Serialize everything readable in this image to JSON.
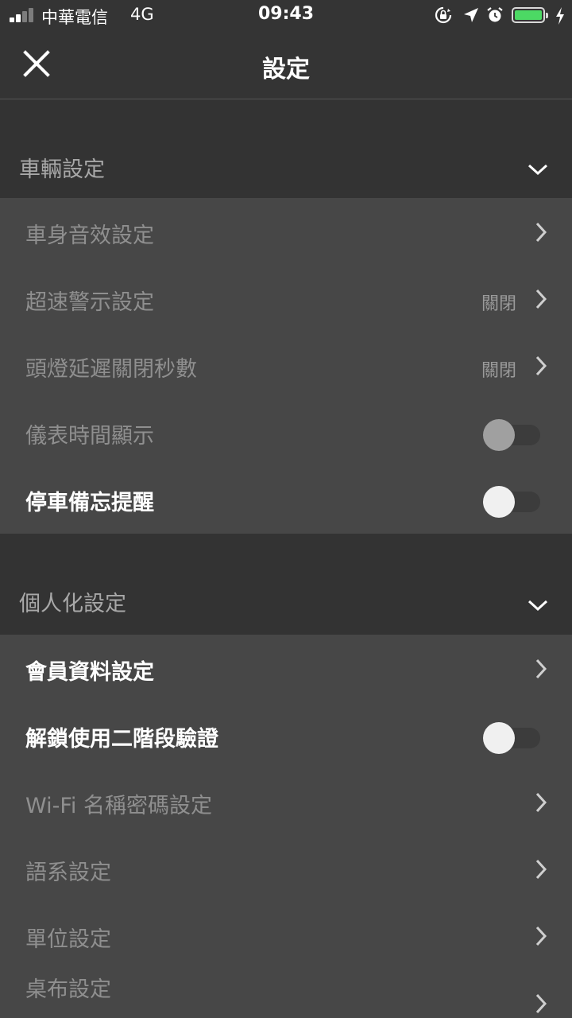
{
  "status_bar": {
    "carrier": "中華電信",
    "network": "4G",
    "time": "09:43",
    "icons": [
      "orientation-lock-icon",
      "location-arrow-icon",
      "alarm-icon",
      "battery-icon",
      "charging-bolt-icon"
    ],
    "battery_level": 1.0,
    "battery_color": "#4cd964"
  },
  "nav": {
    "title": "設定",
    "close_icon": "close-icon"
  },
  "sections": {
    "vehicle": {
      "title": "車輛設定",
      "items": [
        {
          "label": "車身音效設定",
          "value": "",
          "control": "chevron"
        },
        {
          "label": "超速警示設定",
          "value": "關閉",
          "control": "chevron"
        },
        {
          "label": "頭燈延遲關閉秒數",
          "value": "關閉",
          "control": "chevron"
        },
        {
          "label": "儀表時間顯示",
          "value": "",
          "control": "toggle",
          "on": false,
          "enabled": false
        },
        {
          "label": "停車備忘提醒",
          "value": "",
          "control": "toggle",
          "on": false,
          "enabled": true
        }
      ]
    },
    "personal": {
      "title": "個人化設定",
      "items": [
        {
          "label": "會員資料設定",
          "value": "",
          "control": "chevron"
        },
        {
          "label": "解鎖使用二階段驗證",
          "value": "",
          "control": "toggle",
          "on": false,
          "enabled": true
        },
        {
          "label": "Wi-Fi 名稱密碼設定",
          "value": "",
          "control": "chevron"
        },
        {
          "label": "語系設定",
          "value": "",
          "control": "chevron"
        },
        {
          "label": "單位設定",
          "value": "",
          "control": "chevron"
        },
        {
          "label": "桌布設定",
          "value": "",
          "control": "chevron"
        }
      ]
    }
  },
  "colors": {
    "background": "#474747",
    "header": "#343434",
    "section_header": "#333333",
    "text_bright": "#ffffff",
    "text_dim": "#8f8f8f"
  }
}
